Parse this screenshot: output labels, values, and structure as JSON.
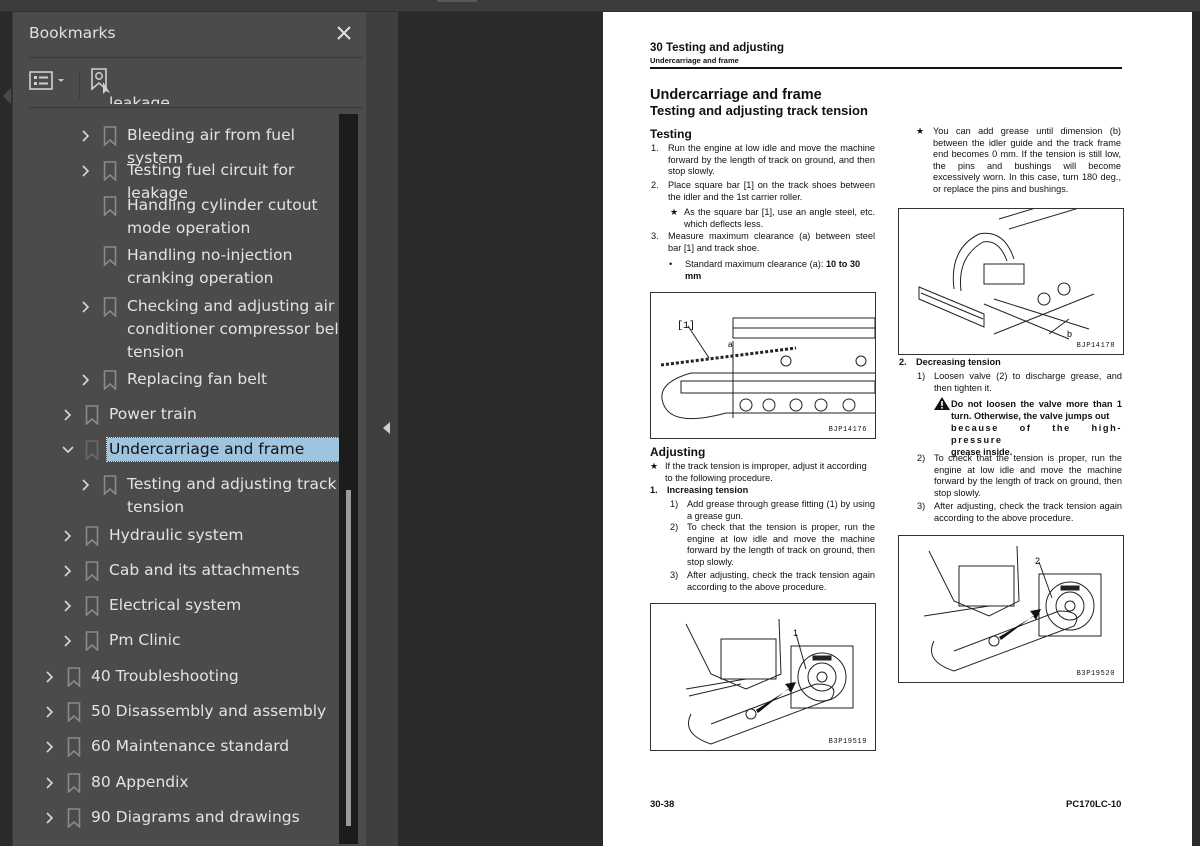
{
  "panel": {
    "title": "Bookmarks",
    "close_icon": "close-icon",
    "options_icon": "list-options-icon",
    "find_icon": "find-current-bookmark-icon",
    "partial_item": "leakage",
    "items": [
      {
        "label": "Bleeding air from fuel system",
        "level": 2,
        "expander": "collapsed"
      },
      {
        "label": "Testing fuel circuit for leakage",
        "level": 2,
        "expander": "collapsed"
      },
      {
        "label": "Handling cylinder cutout mode operation",
        "level": 2,
        "expander": "none"
      },
      {
        "label": "Handling no-injection cranking operation",
        "level": 2,
        "expander": "none"
      },
      {
        "label": "Checking and adjusting air conditioner compressor belt tension",
        "level": 2,
        "expander": "collapsed"
      },
      {
        "label": "Replacing fan belt",
        "level": 2,
        "expander": "collapsed"
      },
      {
        "label": "Power train",
        "level": 1,
        "expander": "collapsed"
      },
      {
        "label": "Undercarriage and frame",
        "level": 1,
        "expander": "expanded",
        "selected": true
      },
      {
        "label": "Testing and adjusting track tension",
        "level": 2,
        "expander": "collapsed"
      },
      {
        "label": "Hydraulic system",
        "level": 1,
        "expander": "collapsed"
      },
      {
        "label": "Cab and its attachments",
        "level": 1,
        "expander": "collapsed"
      },
      {
        "label": "Electrical system",
        "level": 1,
        "expander": "collapsed"
      },
      {
        "label": "Pm Clinic",
        "level": 1,
        "expander": "collapsed"
      },
      {
        "label": "40 Troubleshooting",
        "level": 0,
        "expander": "collapsed"
      },
      {
        "label": "50 Disassembly and assembly",
        "level": 0,
        "expander": "collapsed"
      },
      {
        "label": "60 Maintenance standard",
        "level": 0,
        "expander": "collapsed"
      },
      {
        "label": "80 Appendix",
        "level": 0,
        "expander": "collapsed"
      },
      {
        "label": "90 Diagrams and drawings",
        "level": 0,
        "expander": "collapsed"
      }
    ],
    "selection_color": "#9ec4e0"
  },
  "document": {
    "running_head": "30 Testing and adjusting",
    "running_sub": "Undercarriage and frame",
    "title": "Undercarriage and frame",
    "subtitle": "Testing and adjusting track tension",
    "testing_heading": "Testing",
    "testing_steps": [
      {
        "num": "1.",
        "text": "Run the engine at low idle and move the machine forward by the length of track on ground, and then stop slowly."
      },
      {
        "num": "2.",
        "text": "Place square bar [1] on the track shoes between the idler and the 1st carrier roller."
      },
      {
        "num": "★",
        "text": "As the square bar [1], use an angle steel, etc. which deflects less."
      },
      {
        "num": "3.",
        "text": "Measure maximum clearance (a) between steel bar [1] and track shoe."
      },
      {
        "num": "•",
        "text": "Standard maximum clearance (a): ",
        "bold": "10 to 30 mm"
      }
    ],
    "fig1": {
      "caption": "BJP14176",
      "label_bar": "[1]",
      "label_a": "a"
    },
    "adjusting_heading": "Adjusting",
    "adjusting_note": {
      "num": "★",
      "text": "If the track tension is improper, adjust it according to the following procedure."
    },
    "increasing": {
      "num": "1.",
      "heading": "Increasing tension",
      "steps": [
        {
          "num": "1)",
          "text": "Add grease through grease fitting (1) by using a grease gun."
        },
        {
          "num": "2)",
          "text": "To check that the tension is proper, run the engine at low idle and move the machine forward by the length of track on ground, then stop slowly."
        },
        {
          "num": "3)",
          "text": "After adjusting, check the track tension again according to the above procedure."
        }
      ]
    },
    "fig3": {
      "caption": "B3P19519",
      "label": "1"
    },
    "right_note": {
      "num": "★",
      "text": "You can add grease until dimension (b) between the idler guide and the track frame end becomes 0 mm. If the tension is still low, the pins and bushings will become excessively worn. In this case, turn 180 deg., or replace the pins and bushings."
    },
    "fig2": {
      "caption": "BJP14178",
      "label_b": "b"
    },
    "decreasing": {
      "num": "2.",
      "heading": "Decreasing tension",
      "step1": {
        "num": "1)",
        "text": "Loosen valve (2) to discharge grease, and then tighten it."
      },
      "warning_a": "Do not loosen the valve more than 1 turn. Otherwise, the valve jumps out",
      "warning_b": "because of the high-pressure",
      "warning_c": "grease inside.",
      "steps": [
        {
          "num": "2)",
          "text": "To check that the tension is proper, run the engine at low idle and move the machine forward by the length of track on ground, then stop slowly."
        },
        {
          "num": "3)",
          "text": "After adjusting, check the track tension again according to the above procedure."
        }
      ]
    },
    "fig4": {
      "caption": "B3P19520",
      "label": "2"
    },
    "footer_page": "30-38",
    "footer_model": "PC170LC-10"
  }
}
